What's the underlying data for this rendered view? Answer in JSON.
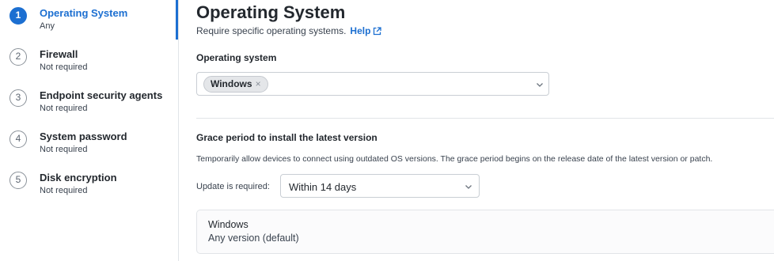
{
  "steps": [
    {
      "number": "1",
      "title": "Operating System",
      "subtitle": "Any",
      "active": true
    },
    {
      "number": "2",
      "title": "Firewall",
      "subtitle": "Not required",
      "active": false
    },
    {
      "number": "3",
      "title": "Endpoint security agents",
      "subtitle": "Not required",
      "active": false
    },
    {
      "number": "4",
      "title": "System password",
      "subtitle": "Not required",
      "active": false
    },
    {
      "number": "5",
      "title": "Disk encryption",
      "subtitle": "Not required",
      "active": false
    }
  ],
  "header": {
    "title": "Operating System",
    "description": "Require specific operating systems.",
    "help_label": "Help"
  },
  "os_field": {
    "label": "Operating system",
    "chips": [
      {
        "label": "Windows",
        "remove_glyph": "×"
      }
    ]
  },
  "grace": {
    "title": "Grace period to install the latest version",
    "description": "Temporarily allow devices to connect using outdated OS versions. The grace period begins on the release date of the latest version or patch.",
    "update_label": "Update is required:",
    "selected": "Within 14 days"
  },
  "os_card": {
    "name": "Windows",
    "version": "Any version (default)"
  },
  "colors": {
    "accent": "#1c6fd1",
    "text": "#23282e",
    "border": "#c9ced4"
  }
}
